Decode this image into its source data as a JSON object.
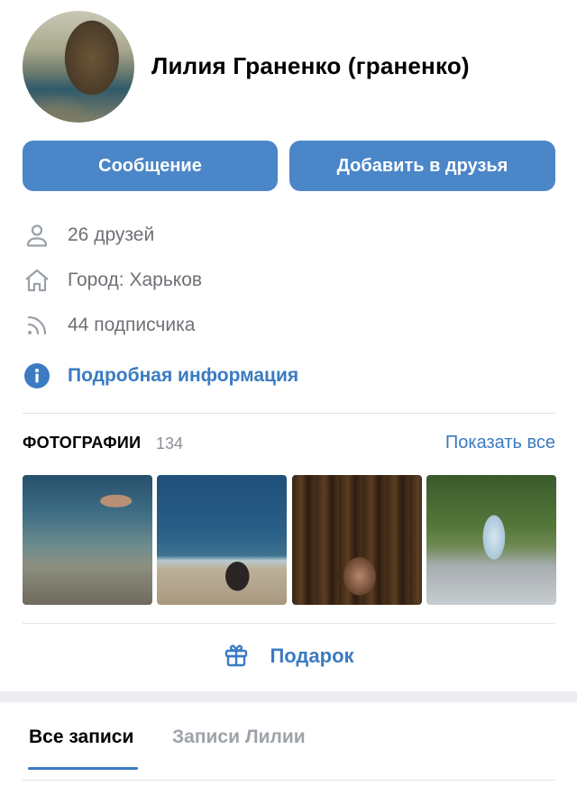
{
  "profile": {
    "name": "Лилия Граненко (граненко)"
  },
  "actions": {
    "message_label": "Сообщение",
    "add_friend_label": "Добавить в друзья"
  },
  "info": {
    "friends": {
      "text": "26 друзей",
      "icon": "person-icon"
    },
    "city": {
      "text": "Город: Харьков",
      "icon": "home-icon"
    },
    "followers": {
      "text": "44 подписчика",
      "icon": "rss-icon"
    },
    "more": {
      "text": "Подробная информация",
      "icon": "info-icon"
    }
  },
  "photos": {
    "title": "ФОТОГРАФИИ",
    "count": "134",
    "show_all": "Показать все"
  },
  "gift": {
    "label": "Подарок",
    "icon": "gift-icon"
  },
  "tabs": [
    {
      "label": "Все записи",
      "active": true
    },
    {
      "label": "Записи Лилии",
      "active": false
    }
  ],
  "colors": {
    "accent": "#3b7bc2",
    "button": "#4a86c8",
    "muted_text": "#6d7075"
  }
}
